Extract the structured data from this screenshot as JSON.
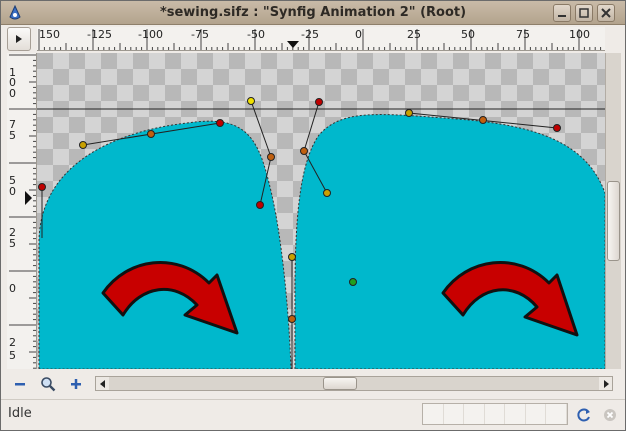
{
  "window": {
    "title": "*sewing.sifz : \"Synfig Animation 2\" (Root)",
    "icons": {
      "app": "synfig-app-icon",
      "minimize": "minimize-icon",
      "maximize": "maximize-icon",
      "close": "close-icon"
    }
  },
  "hruler": {
    "labels": [
      "150",
      "-125",
      "-100",
      "-75",
      "-50",
      "-25",
      "0",
      "25",
      "50",
      "75",
      "100"
    ]
  },
  "vruler": {
    "labels": [
      "1",
      "0",
      "0",
      "7",
      "5",
      "5",
      "0",
      "2",
      "5",
      "0",
      "2",
      "5"
    ]
  },
  "toolbar": {
    "menu_icon": "caret-right-icon",
    "zoom_out_icon": "zoom-out-icon",
    "zoom_fit_icon": "zoom-magnifier-icon",
    "zoom_in_icon": "zoom-in-icon"
  },
  "status": {
    "text": "Idle",
    "refresh_icon": "refresh-icon",
    "stop_icon": "stop-icon"
  },
  "colors": {
    "shape_fill": "#00b8cc",
    "arrow_fill": "#c80000",
    "checker_light": "#d4d4d4",
    "checker_dark": "#b8b8b8"
  }
}
